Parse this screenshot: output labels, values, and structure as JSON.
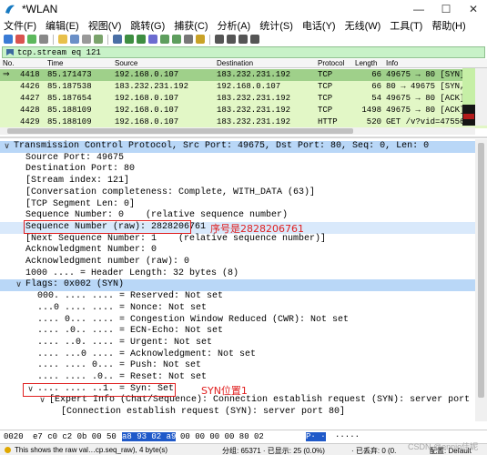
{
  "window": {
    "title": "*WLAN",
    "controls": [
      "—",
      "☐",
      "✕"
    ]
  },
  "menu": [
    "文件(F)",
    "编辑(E)",
    "视图(V)",
    "跳转(G)",
    "捕获(C)",
    "分析(A)",
    "统计(S)",
    "电话(Y)",
    "无线(W)",
    "工具(T)",
    "帮助(H)"
  ],
  "filter": {
    "value": "tcp.stream eq 121"
  },
  "packet_list": {
    "columns": [
      "No.",
      "Time",
      "Source",
      "Destination",
      "Protocol",
      "Length",
      "Info"
    ],
    "rows": [
      {
        "no": "4418",
        "time": "85.171473",
        "src": "192.168.0.107",
        "dst": "183.232.231.192",
        "proto": "TCP",
        "len": "66",
        "info": "49675 → 80 [SYN]"
      },
      {
        "no": "4426",
        "time": "85.187538",
        "src": "183.232.231.192",
        "dst": "192.168.0.107",
        "proto": "TCP",
        "len": "66",
        "info": "80 → 49675 [SYN,"
      },
      {
        "no": "4427",
        "time": "85.187654",
        "src": "192.168.0.107",
        "dst": "183.232.231.192",
        "proto": "TCP",
        "len": "54",
        "info": "49675 → 80 [ACK]"
      },
      {
        "no": "4428",
        "time": "85.188109",
        "src": "192.168.0.107",
        "dst": "183.232.231.192",
        "proto": "TCP",
        "len": "1498",
        "info": "49675 → 80 [ACK]"
      },
      {
        "no": "4429",
        "time": "85.188109",
        "src": "192.168.0.107",
        "dst": "183.232.231.192",
        "proto": "HTTP",
        "len": "520",
        "info": "GET /v?vid=47556"
      }
    ]
  },
  "details": {
    "header": "Transmission Control Protocol, Src Port: 49675, Dst Port: 80, Seq: 0, Len: 0",
    "fields": [
      "Source Port: 49675",
      "Destination Port: 80",
      "[Stream index: 121]",
      "[Conversation completeness: Complete, WITH_DATA (63)]",
      "[TCP Segment Len: 0]",
      "Sequence Number: 0    (relative sequence number)",
      "Sequence Number (raw): 2828206761",
      "[Next Sequence Number: 1    (relative sequence number)]",
      "Acknowledgment Number: 0",
      "Acknowledgment number (raw): 0",
      "1000 .... = Header Length: 32 bytes (8)"
    ],
    "flags_header": "Flags: 0x002 (SYN)",
    "flags": [
      "000. .... .... = Reserved: Not set",
      "...0 .... .... = Nonce: Not set",
      ".... 0... .... = Congestion Window Reduced (CWR): Not set",
      ".... .0.. .... = ECN-Echo: Not set",
      ".... ..0. .... = Urgent: Not set",
      ".... ...0 .... = Acknowledgment: Not set",
      ".... .... 0... = Push: Not set",
      ".... .... .0.. = Reset: Not set",
      ".... .... ..1. = Syn: Set"
    ],
    "expert_info": "[Expert Info (Chat/Sequence): Connection establish request (SYN): server port 80]",
    "expert_detail": "[Connection establish request (SYN): server port 80]"
  },
  "annotations": {
    "seq_note": "序号是2828206761",
    "syn_note": "SYN位置1"
  },
  "bytes": {
    "offset": "0020",
    "pre": "e7 c0 c2 0b 00 50",
    "hl": "a8 93  02 a9",
    "post": "00 00 00 00 80 02",
    "ascii_hl": "P·  ·",
    "ascii_post": "·····"
  },
  "status": {
    "left": "This shows the raw val…cp.seq_raw), 4 byte(s)",
    "packets": "分组: 65371 · 已显示: 25 (0.0%)",
    "dropped": "· 已丢弃: 0 (0.",
    "profile": "配置: Default"
  },
  "watermark": "CSDN @ennio佳妮",
  "colors": {
    "accent_green": "#c8f2c8",
    "row_green": "#e2f7c6",
    "row_selected": "#9fd08a",
    "detail_header": "#b9d7f7",
    "annotation_red": "#e02020",
    "byte_highlight": "#1f59c9"
  }
}
